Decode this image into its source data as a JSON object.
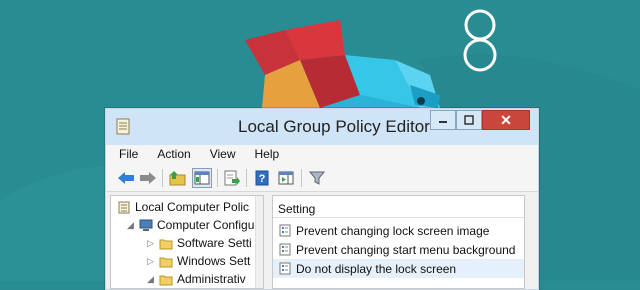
{
  "window": {
    "title": "Local Group Policy Editor",
    "close_glyph": "✕"
  },
  "menu": {
    "items": [
      "File",
      "Action",
      "View",
      "Help"
    ]
  },
  "toolbar": {
    "buttons": [
      "back-icon",
      "forward-icon",
      "up-folder-icon",
      "show-hide-tree-icon",
      "export-list-icon",
      "help-icon",
      "show-action-pane-icon",
      "filter-icon"
    ]
  },
  "tree": {
    "items": [
      {
        "label": "Local Computer Polic",
        "icon": "policy-icon",
        "level": 0
      },
      {
        "label": "Computer Configu",
        "icon": "computer-icon",
        "level": 1,
        "arrow": "collapse"
      },
      {
        "label": "Software Setti",
        "icon": "folder-icon",
        "level": 2,
        "arrow": "expand"
      },
      {
        "label": "Windows Sett",
        "icon": "folder-icon",
        "level": 2,
        "arrow": "expand"
      },
      {
        "label": "Administrativ",
        "icon": "folder-icon",
        "level": 2,
        "arrow": "collapse"
      }
    ]
  },
  "list": {
    "header": "Setting",
    "rows": [
      {
        "label": "Prevent changing lock screen image",
        "icon": "setting-icon"
      },
      {
        "label": "Prevent changing start menu background",
        "icon": "setting-icon"
      },
      {
        "label": "Do not display the lock screen",
        "icon": "setting-icon",
        "selected": true
      }
    ]
  },
  "colors": {
    "desktop": "#2a8c93",
    "titlebar": "#cfe4f6",
    "close": "#c9463d"
  }
}
